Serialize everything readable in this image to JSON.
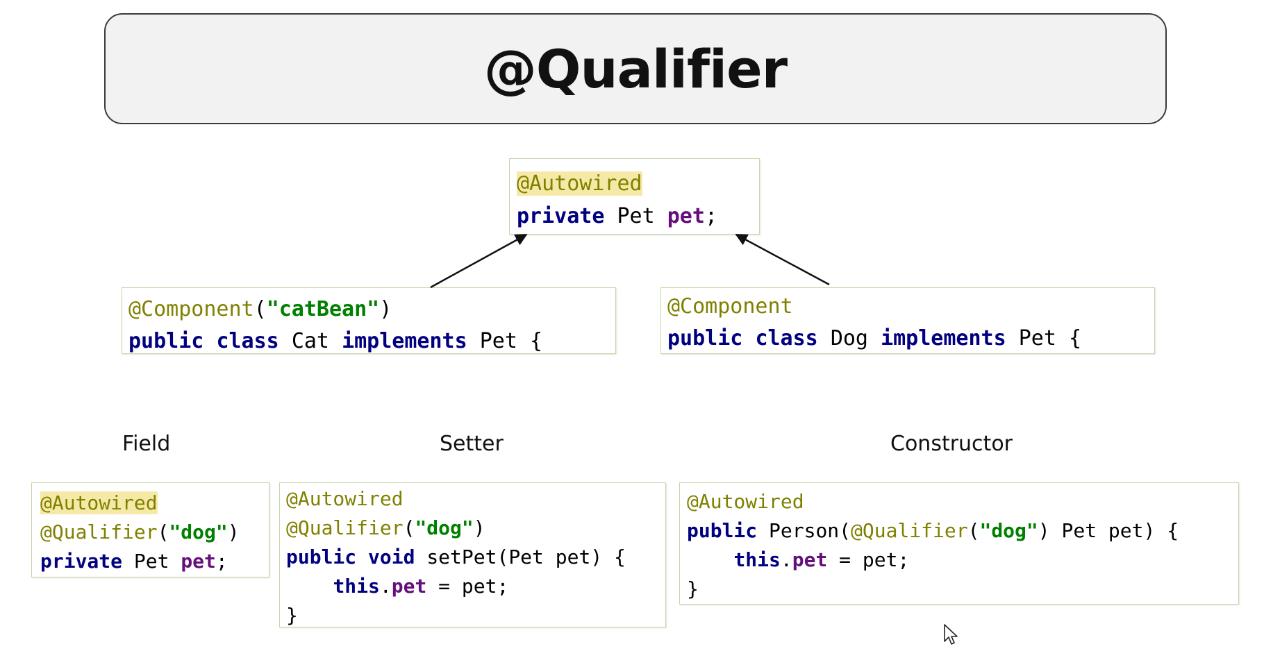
{
  "title": "@Qualifier",
  "top_snippet": {
    "annotation": "@Autowired",
    "line2": {
      "private": "private",
      "type": "Pet",
      "field": "pet",
      "semi": ";"
    }
  },
  "cat_snippet": {
    "annotation": "@Component",
    "open": "(",
    "name": "\"catBean\"",
    "close": ")",
    "line2": {
      "public": "public",
      "class": "class",
      "name": "Cat",
      "implements": "implements",
      "iface": "Pet",
      "brace": "{"
    }
  },
  "dog_snippet": {
    "annotation": "@Component",
    "line2": {
      "public": "public",
      "class": "class",
      "name": "Dog",
      "implements": "implements",
      "iface": "Pet",
      "brace": "{"
    }
  },
  "labels": {
    "field": "Field",
    "setter": "Setter",
    "constructor": "Constructor"
  },
  "field_snippet": {
    "autowired": "@Autowired",
    "qualifier": "@Qualifier",
    "open": "(",
    "value": "\"dog\"",
    "close": ")",
    "line3": {
      "private": "private",
      "type": "Pet",
      "field": "pet",
      "semi": ";"
    }
  },
  "setter_snippet": {
    "autowired": "@Autowired",
    "qualifier": "@Qualifier",
    "open": "(",
    "value": "\"dog\"",
    "close": ")",
    "line3": {
      "public": "public",
      "void": "void",
      "sig": "setPet(Pet pet)",
      "brace": "{"
    },
    "line4": {
      "this": "this",
      "dot": ".",
      "field": "pet",
      "rest": " = pet;"
    },
    "line5": "}"
  },
  "ctor_snippet": {
    "autowired": "@Autowired",
    "line2": {
      "public": "public",
      "name": "Person(",
      "qualifier": "@Qualifier",
      "open": "(",
      "value": "\"dog\"",
      "rest": ") Pet pet) {"
    },
    "line3": {
      "this": "this",
      "dot": ".",
      "field": "pet",
      "rest": " = pet;"
    },
    "line4": "}"
  },
  "colors": {
    "annotation": "#808000",
    "keyword": "#000080",
    "string": "#008000",
    "field": "#660e7a",
    "highlight": "#f6e9a8",
    "box_border": "#c6d7a6"
  },
  "icons": {
    "cursor": "mouse-pointer-icon"
  }
}
